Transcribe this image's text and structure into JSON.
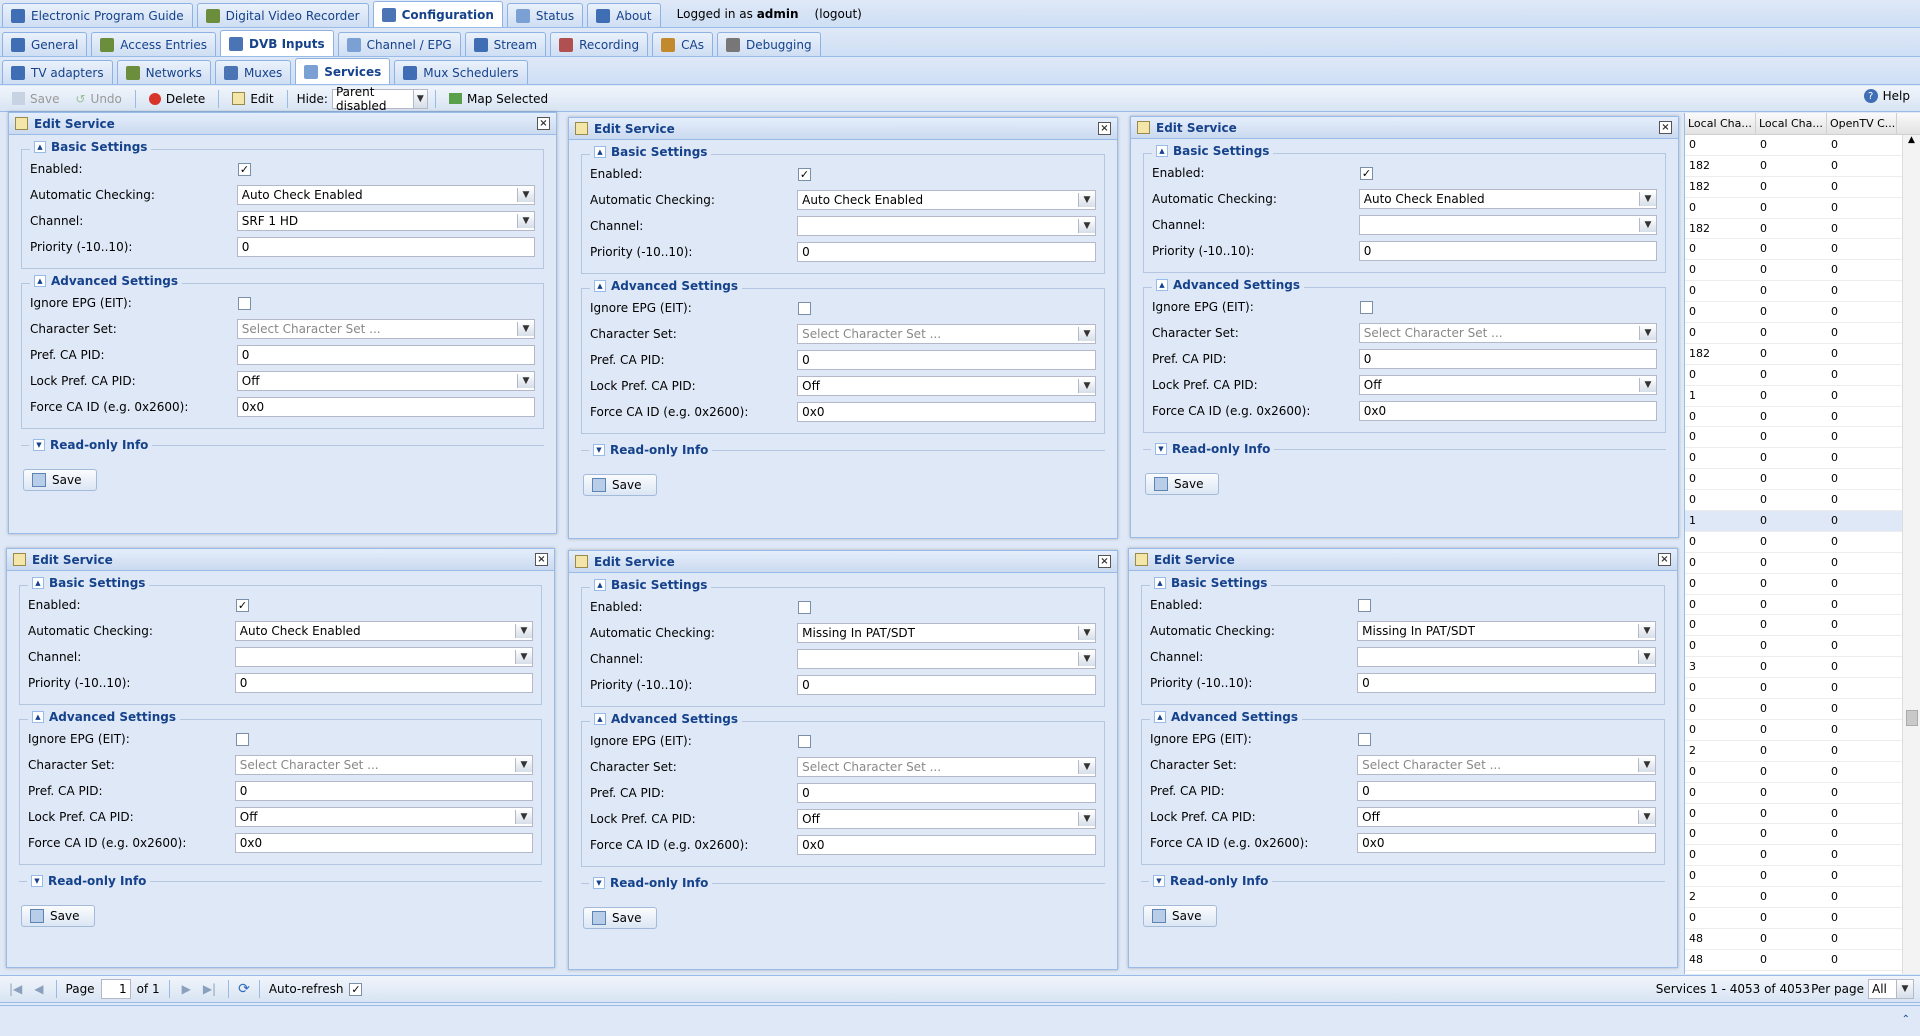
{
  "topnav": {
    "tabs": [
      {
        "label": "Electronic Program Guide",
        "icon": "epg-icon",
        "active": false
      },
      {
        "label": "Digital Video Recorder",
        "icon": "dvr-icon",
        "active": false
      },
      {
        "label": "Configuration",
        "icon": "wrench-icon",
        "active": true
      },
      {
        "label": "Status",
        "icon": "status-icon",
        "active": false
      },
      {
        "label": "About",
        "icon": "info-icon",
        "active": false
      }
    ],
    "logged_in_prefix": "Logged in as",
    "user": "admin",
    "logout": "(logout)"
  },
  "confnav": {
    "tabs": [
      {
        "label": "General",
        "icon": "tools-icon",
        "active": false
      },
      {
        "label": "Access Entries",
        "icon": "users-icon",
        "active": false
      },
      {
        "label": "DVB Inputs",
        "icon": "tv-icon",
        "active": true
      },
      {
        "label": "Channel / EPG",
        "icon": "channel-icon",
        "active": false
      },
      {
        "label": "Stream",
        "icon": "stream-icon",
        "active": false
      },
      {
        "label": "Recording",
        "icon": "record-icon",
        "active": false
      },
      {
        "label": "CAs",
        "icon": "key-icon",
        "active": false
      },
      {
        "label": "Debugging",
        "icon": "bug-icon",
        "active": false
      }
    ]
  },
  "dvbnav": {
    "tabs": [
      {
        "label": "TV adapters",
        "icon": "adapter-icon",
        "active": false
      },
      {
        "label": "Networks",
        "icon": "antenna-icon",
        "active": false
      },
      {
        "label": "Muxes",
        "icon": "mux-icon",
        "active": false
      },
      {
        "label": "Services",
        "icon": "services-icon",
        "active": true
      },
      {
        "label": "Mux Schedulers",
        "icon": "scheduler-icon",
        "active": false
      }
    ]
  },
  "toolbar": {
    "save": "Save",
    "undo": "Undo",
    "delete": "Delete",
    "edit": "Edit",
    "hide_label": "Hide:",
    "hide_value": "Parent disabled",
    "map_selected": "Map Selected",
    "help": "Help"
  },
  "labels": {
    "panel_title": "Edit Service",
    "basic": "Basic Settings",
    "advanced": "Advanced Settings",
    "readonly": "Read-only Info",
    "enabled": "Enabled:",
    "auto_check": "Automatic Checking:",
    "channel": "Channel:",
    "priority": "Priority (-10..10):",
    "ignore_epg": "Ignore EPG (EIT):",
    "charset": "Character Set:",
    "pref_ca_pid": "Pref. CA PID:",
    "lock_pref": "Lock Pref. CA PID:",
    "force_ca": "Force CA ID (e.g. 0x2600):",
    "save": "Save"
  },
  "panels": [
    {
      "enabled": true,
      "auto_check": "Auto Check Enabled",
      "channel": "SRF 1 HD",
      "priority": "0",
      "charset_placeholder": "Select Character Set ...",
      "pref_ca_pid": "0",
      "lock": "Off",
      "force_ca": "0x0"
    },
    {
      "enabled": true,
      "auto_check": "Auto Check Enabled",
      "channel": "",
      "priority": "0",
      "charset_placeholder": "Select Character Set ...",
      "pref_ca_pid": "0",
      "lock": "Off",
      "force_ca": "0x0"
    },
    {
      "enabled": true,
      "auto_check": "Auto Check Enabled",
      "channel": "",
      "priority": "0",
      "charset_placeholder": "Select Character Set ...",
      "pref_ca_pid": "0",
      "lock": "Off",
      "force_ca": "0x0"
    },
    {
      "enabled": true,
      "auto_check": "Auto Check Enabled",
      "channel": "",
      "priority": "0",
      "charset_placeholder": "Select Character Set ...",
      "pref_ca_pid": "0",
      "lock": "Off",
      "force_ca": "0x0"
    },
    {
      "enabled": false,
      "auto_check": "Missing In PAT/SDT",
      "channel": "",
      "priority": "0",
      "charset_placeholder": "Select Character Set ...",
      "pref_ca_pid": "0",
      "lock": "Off",
      "force_ca": "0x0"
    },
    {
      "enabled": false,
      "auto_check": "Missing In PAT/SDT",
      "channel": "",
      "priority": "0",
      "charset_placeholder": "Select Character Set ...",
      "pref_ca_pid": "0",
      "lock": "Off",
      "force_ca": "0x0"
    }
  ],
  "grid": {
    "headers": [
      "Local Cha...",
      "Local Cha...",
      "OpenTV C..."
    ],
    "rows": [
      [
        "0",
        "0",
        "0"
      ],
      [
        "182",
        "0",
        "0"
      ],
      [
        "182",
        "0",
        "0"
      ],
      [
        "0",
        "0",
        "0"
      ],
      [
        "182",
        "0",
        "0"
      ],
      [
        "0",
        "0",
        "0"
      ],
      [
        "0",
        "0",
        "0"
      ],
      [
        "0",
        "0",
        "0"
      ],
      [
        "0",
        "0",
        "0"
      ],
      [
        "0",
        "0",
        "0"
      ],
      [
        "182",
        "0",
        "0"
      ],
      [
        "0",
        "0",
        "0"
      ],
      [
        "1",
        "0",
        "0"
      ],
      [
        "0",
        "0",
        "0"
      ],
      [
        "0",
        "0",
        "0"
      ],
      [
        "0",
        "0",
        "0"
      ],
      [
        "0",
        "0",
        "0"
      ],
      [
        "0",
        "0",
        "0"
      ],
      [
        "1",
        "0",
        "0"
      ],
      [
        "0",
        "0",
        "0"
      ],
      [
        "0",
        "0",
        "0"
      ],
      [
        "0",
        "0",
        "0"
      ],
      [
        "0",
        "0",
        "0"
      ],
      [
        "0",
        "0",
        "0"
      ],
      [
        "0",
        "0",
        "0"
      ],
      [
        "3",
        "0",
        "0"
      ],
      [
        "0",
        "0",
        "0"
      ],
      [
        "0",
        "0",
        "0"
      ],
      [
        "0",
        "0",
        "0"
      ],
      [
        "2",
        "0",
        "0"
      ],
      [
        "0",
        "0",
        "0"
      ],
      [
        "0",
        "0",
        "0"
      ],
      [
        "0",
        "0",
        "0"
      ],
      [
        "0",
        "0",
        "0"
      ],
      [
        "0",
        "0",
        "0"
      ],
      [
        "0",
        "0",
        "0"
      ],
      [
        "2",
        "0",
        "0"
      ],
      [
        "0",
        "0",
        "0"
      ],
      [
        "48",
        "0",
        "0"
      ],
      [
        "48",
        "0",
        "0"
      ],
      [
        "48",
        "0",
        "0"
      ]
    ],
    "selected_row": 18
  },
  "pager": {
    "page_label": "Page",
    "page": "1",
    "of": "of 1",
    "auto_refresh": "Auto-refresh",
    "summary": "Services 1 - 4053 of 4053",
    "per_page_label": "Per page",
    "per_page": "All"
  },
  "colors": {
    "accent": "#15428b",
    "border": "#99bbe8",
    "background": "#dfe8f6"
  }
}
